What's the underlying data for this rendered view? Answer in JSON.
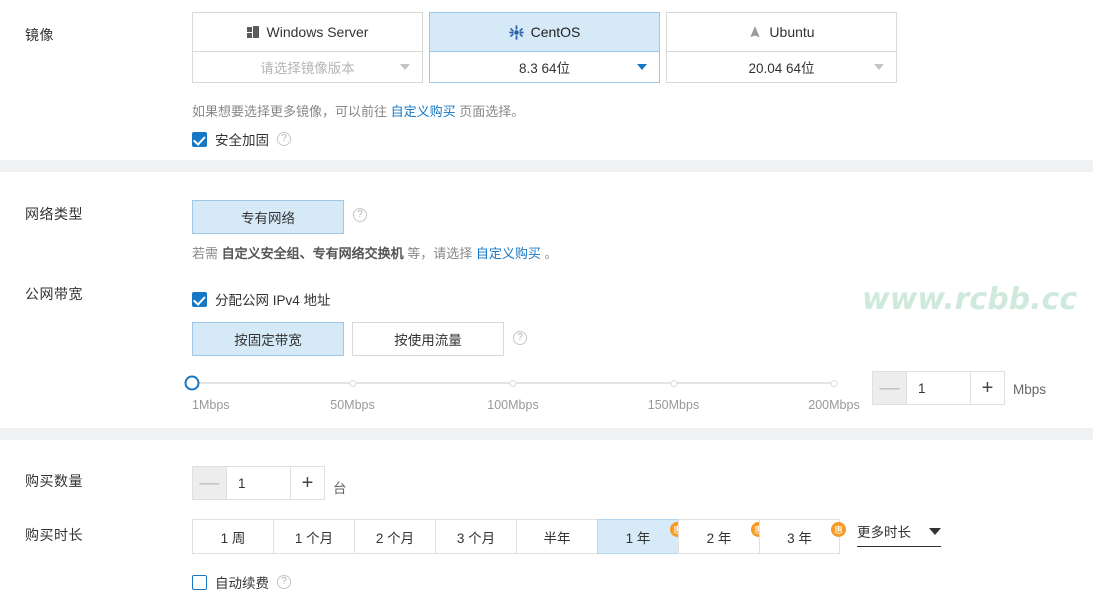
{
  "sections": {
    "image": {
      "label": "镜像",
      "cards": [
        {
          "name": "Windows Server",
          "icon": "windows-icon",
          "version": "请选择镜像版本",
          "version_is_placeholder": true,
          "selected": false
        },
        {
          "name": "CentOS",
          "icon": "centos-icon",
          "version": "8.3 64位",
          "version_is_placeholder": false,
          "selected": true
        },
        {
          "name": "Ubuntu",
          "icon": "ubuntu-icon",
          "version": "20.04 64位",
          "version_is_placeholder": false,
          "selected": false
        }
      ],
      "hint_prefix": "如果想要选择更多镜像，可以前往 ",
      "hint_link": "自定义购买",
      "hint_suffix": " 页面选择。",
      "security_checkbox": {
        "label": "安全加固",
        "checked": true
      }
    },
    "network": {
      "label": "网络类型",
      "type_button": "专有网络",
      "hint_prefix": "若需 ",
      "hint_bold": "自定义安全组、专有网络交换机",
      "hint_middle": " 等，请选择 ",
      "hint_link": "自定义购买",
      "hint_suffix": " 。"
    },
    "bandwidth": {
      "label": "公网带宽",
      "ipv4_checkbox": {
        "label": "分配公网 IPv4 地址",
        "checked": true
      },
      "mode_buttons": [
        {
          "label": "按固定带宽",
          "active": true
        },
        {
          "label": "按使用流量",
          "active": false
        }
      ],
      "slider_ticks": [
        "1Mbps",
        "50Mbps",
        "100Mbps",
        "150Mbps",
        "200Mbps"
      ],
      "slider_value": 1,
      "stepper_value": "1",
      "unit": "Mbps",
      "minus_label": "—",
      "plus_label": "+"
    },
    "quantity": {
      "label": "购买数量",
      "value": "1",
      "unit": "台",
      "minus_label": "—",
      "plus_label": "+"
    },
    "duration": {
      "label": "购买时长",
      "options": [
        {
          "label": "1 周",
          "active": false,
          "badge": null
        },
        {
          "label": "1 个月",
          "active": false,
          "badge": null
        },
        {
          "label": "2 个月",
          "active": false,
          "badge": null
        },
        {
          "label": "3 个月",
          "active": false,
          "badge": null
        },
        {
          "label": "半年",
          "active": false,
          "badge": null
        },
        {
          "label": "1 年",
          "active": true,
          "badge": "惠"
        },
        {
          "label": "2 年",
          "active": false,
          "badge": "惠"
        },
        {
          "label": "3 年",
          "active": false,
          "badge": "惠"
        }
      ],
      "more_label": "更多时长",
      "auto_renew": {
        "label": "自动续费",
        "checked": false
      }
    }
  },
  "watermark": "www.rcbb.cc",
  "colors": {
    "accent": "#1677c4",
    "selected_bg": "#d6e9f7",
    "badge": "#f59a23",
    "watermark": "#cfeadd"
  }
}
